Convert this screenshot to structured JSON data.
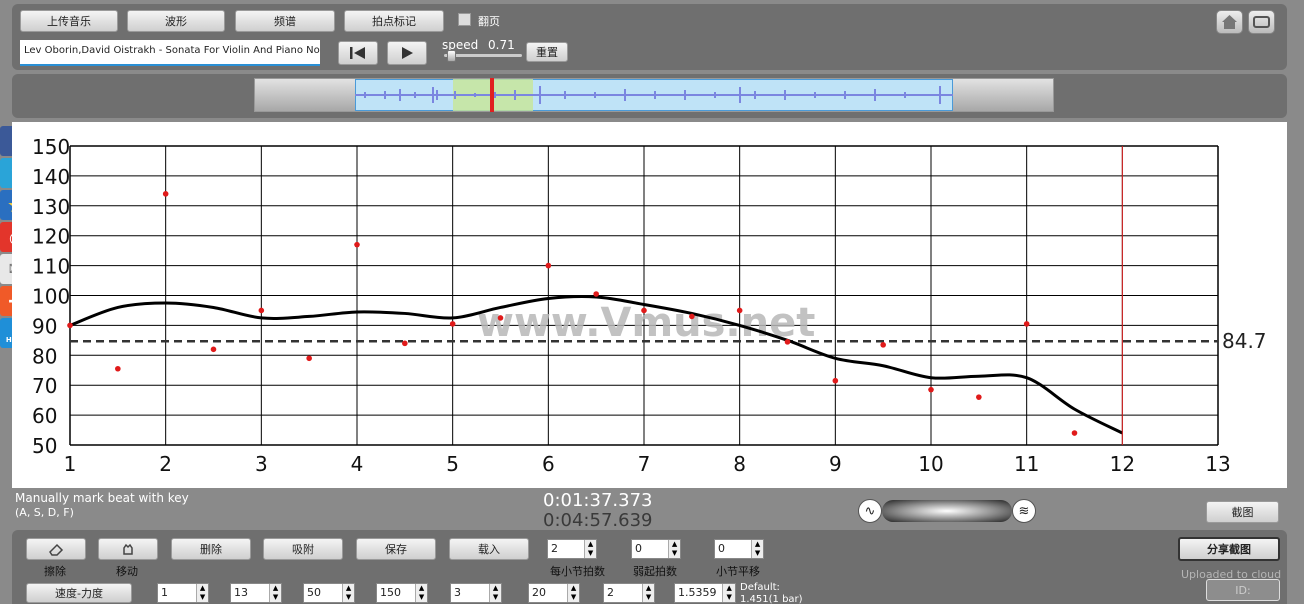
{
  "toolbar": {
    "upload_label": "上传音乐",
    "waveform_label": "波形",
    "spectrum_label": "频谱",
    "tap_mark_label": "拍点标记",
    "page_turn_label": "翻页",
    "track_title": "Lev Oborin,David Oistrakh - Sonata For Violin And Piano No.",
    "speed_label": "speed",
    "speed_value": "0.71",
    "reset_label": "重置"
  },
  "watermark": "www.Vmus.net",
  "chart_data": {
    "type": "scatter",
    "xlim": [
      1,
      13
    ],
    "ylim": [
      50,
      150
    ],
    "x_ticks": [
      1,
      2,
      3,
      4,
      5,
      6,
      7,
      8,
      9,
      10,
      11,
      12,
      13
    ],
    "y_ticks": [
      50,
      60,
      70,
      80,
      90,
      100,
      110,
      120,
      130,
      140,
      150
    ],
    "average_value": 84.7,
    "average_label": "84.7",
    "cursor_x": 12,
    "points": [
      [
        1,
        90
      ],
      [
        1.5,
        75.5
      ],
      [
        2,
        134
      ],
      [
        2.5,
        82
      ],
      [
        3,
        95
      ],
      [
        3.5,
        79
      ],
      [
        4,
        117
      ],
      [
        4.5,
        84
      ],
      [
        5,
        90.5
      ],
      [
        5.5,
        92.5
      ],
      [
        6,
        110
      ],
      [
        6.5,
        100.5
      ],
      [
        7,
        95
      ],
      [
        7.5,
        93
      ],
      [
        8,
        95
      ],
      [
        8.5,
        84.5
      ],
      [
        9,
        71.5
      ],
      [
        9.5,
        83.5
      ],
      [
        10,
        68.5
      ],
      [
        10.5,
        66
      ],
      [
        11,
        90.5
      ],
      [
        11.5,
        54
      ]
    ],
    "curve": [
      [
        1,
        90
      ],
      [
        1.5,
        96
      ],
      [
        2,
        97.5
      ],
      [
        2.5,
        96
      ],
      [
        3,
        92.5
      ],
      [
        3.5,
        93
      ],
      [
        4,
        94.5
      ],
      [
        4.5,
        94
      ],
      [
        5,
        92.5
      ],
      [
        5.5,
        96
      ],
      [
        6,
        99
      ],
      [
        6.5,
        99.5
      ],
      [
        7,
        97
      ],
      [
        7.5,
        94
      ],
      [
        8,
        90
      ],
      [
        8.5,
        85
      ],
      [
        9,
        79
      ],
      [
        9.5,
        76.5
      ],
      [
        10,
        72.5
      ],
      [
        10.5,
        73
      ],
      [
        11,
        72.5
      ],
      [
        11.5,
        62
      ],
      [
        12,
        54
      ]
    ]
  },
  "status": {
    "hint_line1": "Manually mark beat with key",
    "hint_line2": "(A, S, D, F)",
    "time_current": "0:01:37.373",
    "time_total": "0:04:57.639",
    "screenshot_label": "截图"
  },
  "bottom": {
    "erase_label": "擦除",
    "move_label": "移动",
    "delete_label": "删除",
    "snap_label": "吸附",
    "save_label": "保存",
    "load_label": "载入",
    "beats_per_bar_label": "每小节拍数",
    "beats_per_bar_value": "2",
    "pickup_label": "弱起拍数",
    "pickup_value": "0",
    "bar_shift_label": "小节平移",
    "bar_shift_value": "0",
    "share_label": "分享截图",
    "uploaded_label": "Uploaded to cloud",
    "tempo_dynamics_label": "速度-力度",
    "field1": "1",
    "field2": "13",
    "field3": "50",
    "field4": "150",
    "field5": "3",
    "field6": "20",
    "field7": "2",
    "field8": "1.5359",
    "default_line1": "Default:",
    "default_line2": "1.451(1 bar)",
    "id_label": "ID:"
  },
  "side": {
    "help_label": "HELP"
  }
}
